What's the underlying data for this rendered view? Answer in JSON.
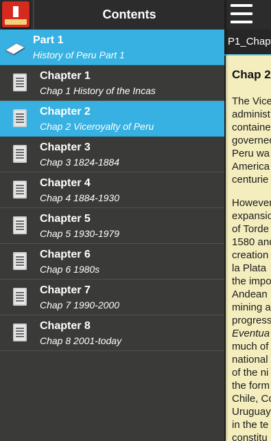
{
  "app_icon_name": "history-of-peru-app-icon",
  "drawer": {
    "title": "Contents",
    "part": {
      "title": "Part 1",
      "subtitle": "History of Peru Part 1"
    },
    "chapters": [
      {
        "title": "Chapter 1",
        "subtitle": "Chap 1 History of the Incas"
      },
      {
        "title": "Chapter 2",
        "subtitle": "Chap 2 Viceroyalty of Peru"
      },
      {
        "title": "Chapter 3",
        "subtitle": "Chap 3 1824-1884"
      },
      {
        "title": "Chapter 4",
        "subtitle": "Chap 4 1884-1930"
      },
      {
        "title": "Chapter 5",
        "subtitle": "Chap 5 1930-1979"
      },
      {
        "title": "Chapter 6",
        "subtitle": "Chap 6 1980s"
      },
      {
        "title": "Chapter 7",
        "subtitle": "Chap 7 1990-2000"
      },
      {
        "title": "Chapter 8",
        "subtitle": "Chap 8 2001-today"
      }
    ],
    "active_index": 1
  },
  "reader": {
    "tab_label": "P1_Chapt",
    "title": "Chap 2",
    "para1": [
      "The Vice",
      "administ",
      "containe",
      "governec",
      "Peru wa",
      "America",
      "centurie"
    ],
    "para2": [
      "However",
      "expansio",
      "of Torde",
      "1580 and",
      "creation",
      "la Plata",
      "the impo",
      "Andean",
      "mining a",
      "progress",
      "Eventua",
      "much of",
      "national",
      "of the ni",
      "the form",
      "Chile, Co",
      "Uruguay",
      "in the te",
      "constitu"
    ]
  },
  "colors": {
    "accent": "#36b1e1",
    "panel": "#3a3b39",
    "paper": "#f4eebe"
  }
}
